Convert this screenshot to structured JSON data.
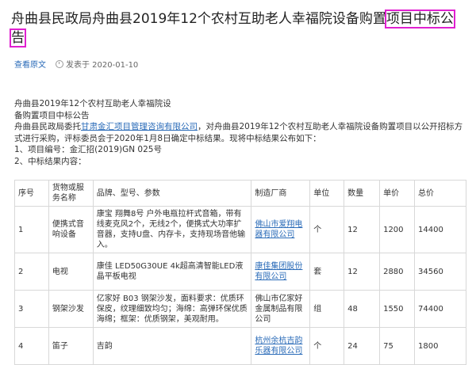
{
  "title": {
    "main": "舟曲县民政局舟曲县2019年12个农村互助老人幸福院设备购置",
    "highlight1": "项目中标公",
    "highlight2": "告"
  },
  "meta": {
    "source_link": "查看原文",
    "publish_label": "发表于 2020-01-10"
  },
  "body": {
    "line1": "舟曲县2019年12个农村互助老人幸福院设",
    "line2": "备购置项目中标公告",
    "para_prefix": "舟曲县民政局委托",
    "agency": "甘肃金汇项目管理咨询有限公司",
    "para_suffix": "，对舟曲县2019年12个农村互助老人幸福院设备购置项目以公开招标方式进行采购，评标委员会于2020年1月8日确定中标结果。现将中标结果公布如下：",
    "item1": "1、项目编号：金汇招(2019)GN 025号",
    "item2": "2、中标结果内容："
  },
  "table": {
    "headers": [
      "序号",
      "货物或服务名称",
      "品牌、型号、参数",
      "制造厂商",
      "单位",
      "数量",
      "单价",
      "总价"
    ],
    "rows": [
      {
        "no": "1",
        "name": "便携式音响设备",
        "spec": "康宝 翔舞8号 户外电瓶拉杆式音箱，带有线麦克风2个，无线2个，便携式大功率扩音器，支持U盘、内存卡，支持现场音他输入。",
        "maker": "佛山市爱翔电器有限公司",
        "unit": "个",
        "qty": "12",
        "price": "1200",
        "total": "14400"
      },
      {
        "no": "2",
        "name": "电视",
        "spec": "康佳 LED50G30UE 4k超高清智能LED液晶平板电视",
        "maker": "康佳集团股份有限公司",
        "unit": "套",
        "qty": "12",
        "price": "2880",
        "total": "34560"
      },
      {
        "no": "3",
        "name": "钢架沙发",
        "spec": "亿家好 B03 钢架沙发，面料要求：优质环保皮，纹理细致均匀；海绵：高弹环保优质海绵；框架：优质钢架，美观耐用。",
        "maker": "佛山市亿家好金属制品有限公司",
        "unit": "组",
        "qty": "48",
        "price": "1550",
        "total": "74400"
      },
      {
        "no": "4",
        "name": "笛子",
        "spec": "吉韵",
        "maker": "杭州余杭吉韵乐器有限公司",
        "unit": "个",
        "qty": "24",
        "price": "75",
        "total": "1800"
      }
    ]
  }
}
